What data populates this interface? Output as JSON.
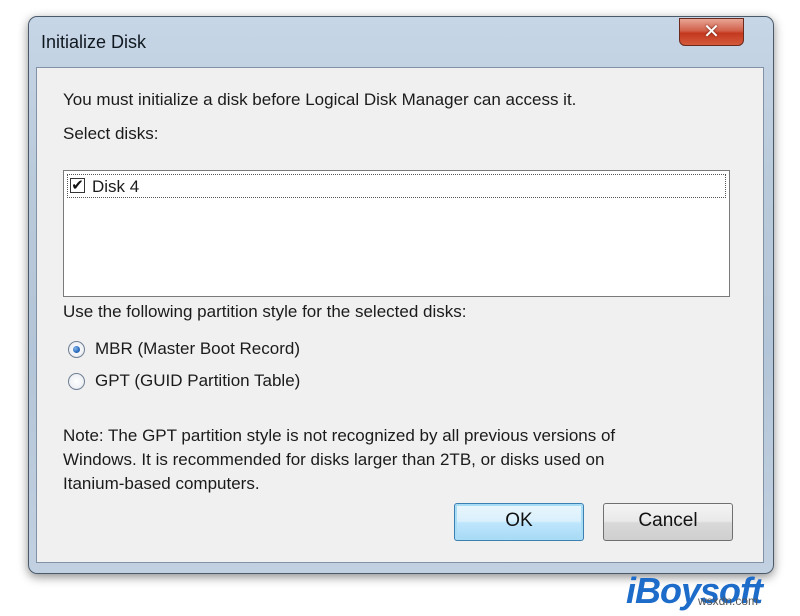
{
  "window": {
    "title": "Initialize Disk",
    "close_glyph": "✕"
  },
  "message": "You must initialize a disk before Logical Disk Manager can access it.",
  "select_disks_label": "Select disks:",
  "disks": [
    {
      "label": "Disk 4",
      "checked": true
    }
  ],
  "partition_style_label": "Use the following partition style for the selected disks:",
  "partition_options": [
    {
      "label": "MBR (Master Boot Record)",
      "selected": true
    },
    {
      "label": "GPT (GUID Partition Table)",
      "selected": false
    }
  ],
  "note_lines": [
    "Note: The GPT partition style is not recognized by all previous versions of",
    "Windows. It is recommended for disks larger than 2TB, or disks used on",
    "Itanium-based computers."
  ],
  "buttons": {
    "ok": "OK",
    "cancel": "Cancel"
  },
  "branding": {
    "logo_text": "iBoysoft",
    "site_text": "wsxdn.com"
  },
  "colors": {
    "accent": "#1d6cc9",
    "close_red": "#c4391f",
    "default_button_border": "#3c7fb1"
  }
}
